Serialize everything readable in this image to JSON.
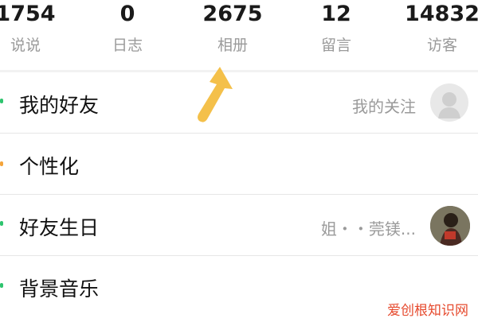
{
  "stats": [
    {
      "number": "1754",
      "label": "说说"
    },
    {
      "number": "0",
      "label": "日志"
    },
    {
      "number": "2675",
      "label": "相册"
    },
    {
      "number": "12",
      "label": "留言"
    },
    {
      "number": "14832",
      "label": "访客"
    }
  ],
  "rows": [
    {
      "title": "我的好友",
      "right": "我的关注"
    },
    {
      "title": "个性化",
      "right": ""
    },
    {
      "title": "好友生日",
      "right": "姐・・莞镁..."
    },
    {
      "title": "背景音乐",
      "right": ""
    }
  ],
  "watermark": "爱创根知识网",
  "colors": {
    "arrow": "#f4c04a",
    "watermark": "#e64a2e"
  }
}
